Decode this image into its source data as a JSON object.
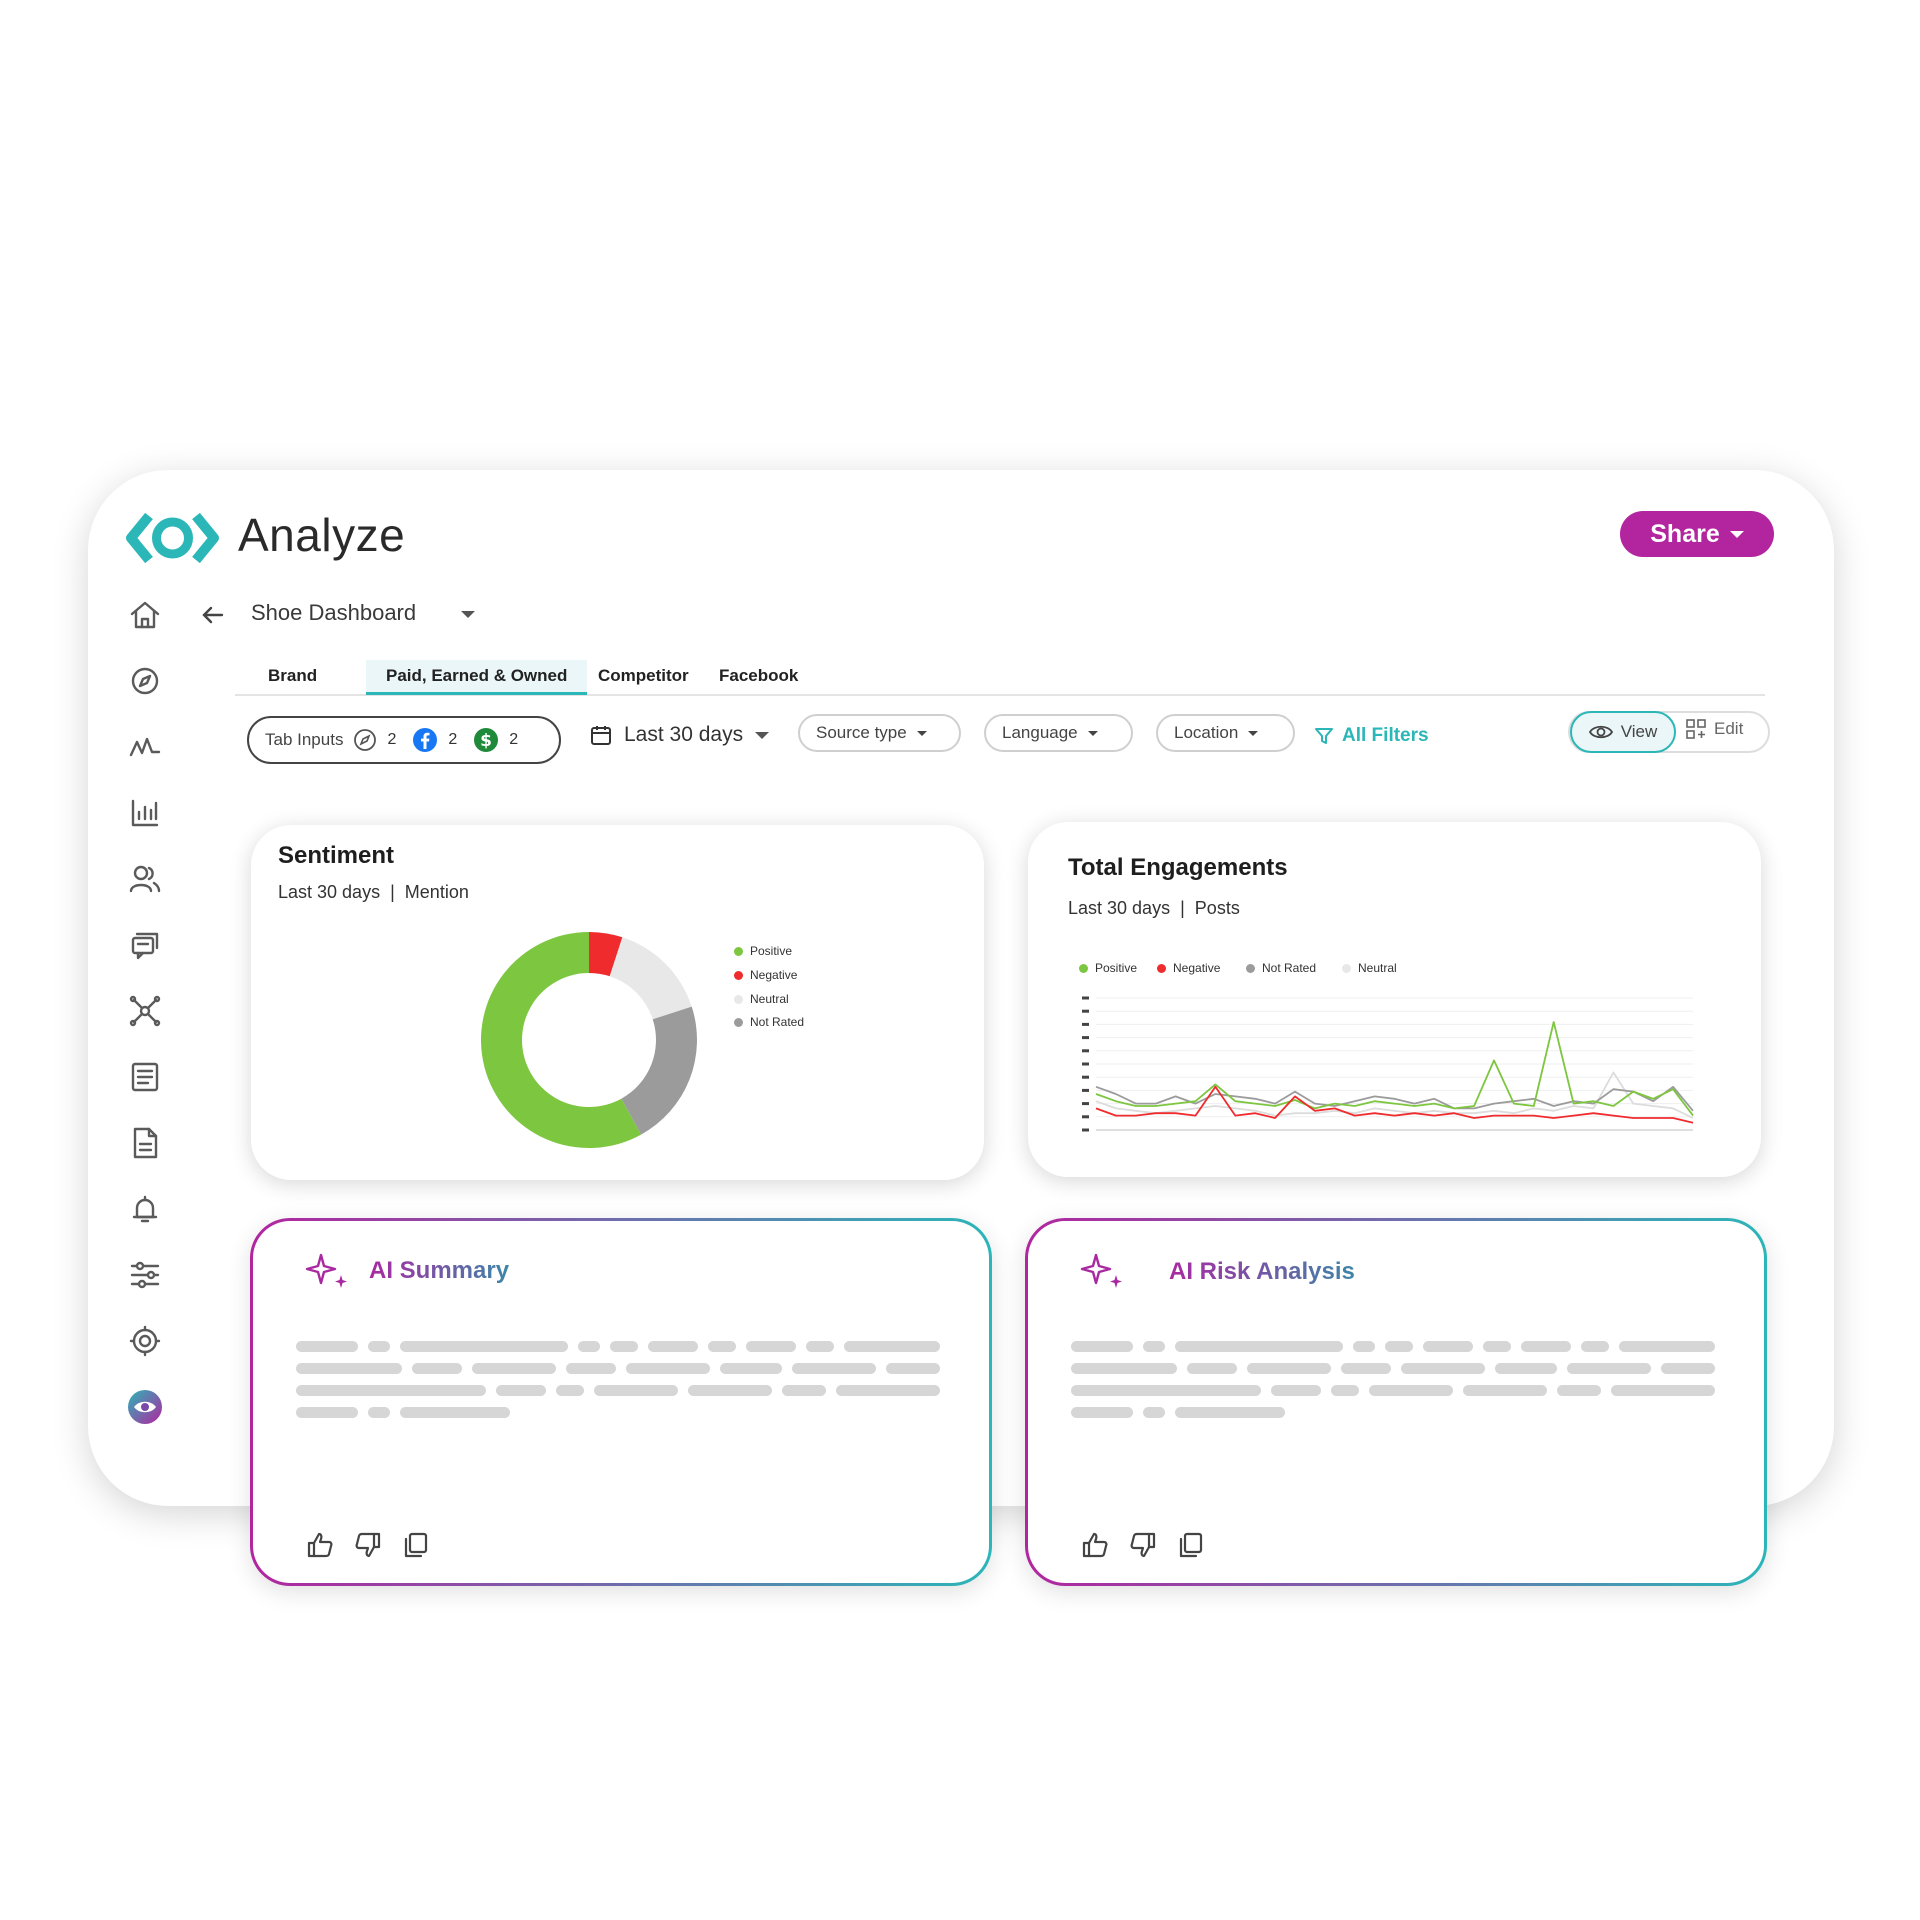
{
  "app": {
    "title": "Analyze",
    "share_label": "Share"
  },
  "colors": {
    "brand": "#2bb6b8",
    "accent": "#b2259f",
    "positive": "#7dc63f",
    "negative": "#ef2b2d",
    "neutral": "#e8e8e8",
    "not_rated": "#9b9b9b"
  },
  "sidebar": {
    "items": [
      "home-icon",
      "compass-icon",
      "activity-icon",
      "bar-chart-icon",
      "users-icon",
      "chat-icon",
      "network-icon",
      "list-icon",
      "document-icon",
      "bell-icon",
      "sliders-icon",
      "settings-icon",
      "eye-logo-icon"
    ]
  },
  "dashboard": {
    "title": "Shoe Dashboard"
  },
  "tabs": [
    {
      "label": "Brand",
      "active": false
    },
    {
      "label": "Paid, Earned & Owned",
      "active": true
    },
    {
      "label": "Competitor",
      "active": false
    },
    {
      "label": "Facebook",
      "active": false
    }
  ],
  "filters": {
    "tab_inputs_label": "Tab Inputs",
    "tab_inputs_counts": [
      "2",
      "2",
      "2"
    ],
    "date_range": "Last 30 days",
    "source_type": "Source type",
    "language": "Language",
    "location": "Location",
    "all_filters": "All Filters",
    "view_label": "View",
    "edit_label": "Edit"
  },
  "sentiment_card": {
    "title": "Sentiment",
    "period": "Last 30 days",
    "metric": "Mention",
    "legend": [
      "Positive",
      "Negative",
      "Neutral",
      "Not Rated"
    ]
  },
  "engagement_card": {
    "title": "Total Engagements",
    "period": "Last 30 days",
    "metric": "Posts",
    "legend": [
      "Positive",
      "Negative",
      "Not Rated",
      "Neutral"
    ]
  },
  "chart_data": [
    {
      "type": "pie",
      "title": "Sentiment",
      "categories": [
        "Positive",
        "Negative",
        "Neutral",
        "Not Rated"
      ],
      "values": [
        0.58,
        0.05,
        0.15,
        0.22
      ]
    },
    {
      "type": "line",
      "title": "Total Engagements",
      "x": [
        1,
        2,
        3,
        4,
        5,
        6,
        7,
        8,
        9,
        10,
        11,
        12,
        13,
        14,
        15,
        16,
        17,
        18,
        19,
        20,
        21,
        22,
        23,
        24,
        25,
        26,
        27,
        28,
        29,
        30,
        31
      ],
      "ylim": [
        0,
        110
      ],
      "series": [
        {
          "name": "Positive",
          "values": [
            30,
            24,
            20,
            20,
            22,
            24,
            38,
            24,
            22,
            20,
            25,
            18,
            22,
            20,
            24,
            22,
            20,
            22,
            18,
            20,
            58,
            22,
            20,
            90,
            22,
            24,
            20,
            32,
            26,
            34,
            12
          ]
        },
        {
          "name": "Negative",
          "values": [
            18,
            12,
            12,
            14,
            14,
            12,
            36,
            12,
            14,
            10,
            28,
            16,
            18,
            12,
            14,
            12,
            14,
            12,
            14,
            10,
            12,
            12,
            12,
            10,
            12,
            14,
            12,
            10,
            10,
            10,
            6
          ]
        },
        {
          "name": "Not Rated",
          "values": [
            36,
            30,
            22,
            22,
            28,
            22,
            30,
            28,
            26,
            22,
            32,
            22,
            20,
            24,
            28,
            26,
            22,
            26,
            18,
            18,
            22,
            24,
            26,
            20,
            24,
            22,
            34,
            32,
            24,
            36,
            16
          ]
        },
        {
          "name": "Neutral",
          "values": [
            24,
            18,
            16,
            14,
            16,
            18,
            20,
            18,
            16,
            12,
            14,
            14,
            16,
            14,
            18,
            16,
            14,
            16,
            14,
            14,
            16,
            14,
            18,
            16,
            20,
            18,
            48,
            22,
            20,
            18,
            10
          ]
        }
      ]
    }
  ],
  "ai_summary": {
    "title": "AI Summary"
  },
  "ai_risk": {
    "title": "AI Risk Analysis"
  }
}
